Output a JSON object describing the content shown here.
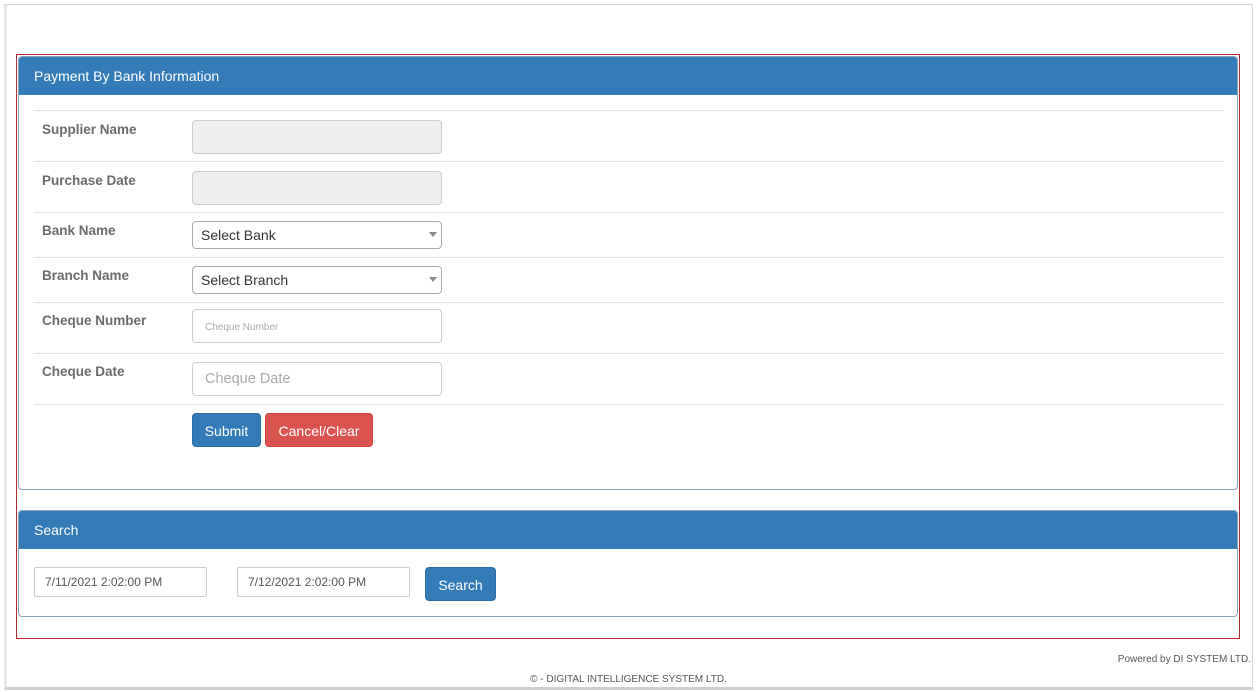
{
  "main_panel": {
    "title": "Payment By Bank Information",
    "fields": {
      "supplier_name": {
        "label": "Supplier Name",
        "value": ""
      },
      "purchase_date": {
        "label": "Purchase Date",
        "value": ""
      },
      "bank_name": {
        "label": "Bank Name",
        "selected": "Select Bank"
      },
      "branch_name": {
        "label": "Branch Name",
        "selected": "Select Branch"
      },
      "cheque_number": {
        "label": "Cheque Number",
        "placeholder": "Cheque Number",
        "value": ""
      },
      "cheque_date": {
        "label": "Cheque Date",
        "placeholder": "Cheque Date",
        "value": ""
      }
    },
    "buttons": {
      "submit": "Submit",
      "cancel": "Cancel/Clear"
    }
  },
  "search_panel": {
    "title": "Search",
    "from_date": "7/11/2021 2:02:00 PM",
    "to_date": "7/12/2021 2:02:00 PM",
    "search_button": "Search"
  },
  "footer": {
    "powered_by": "Powered by DI SYSTEM LTD.",
    "copyright": "© - DIGITAL INTELLIGENCE SYSTEM LTD."
  },
  "colors": {
    "primary": "#337ab7",
    "danger": "#d9534f",
    "outline": "#b22a2e"
  }
}
